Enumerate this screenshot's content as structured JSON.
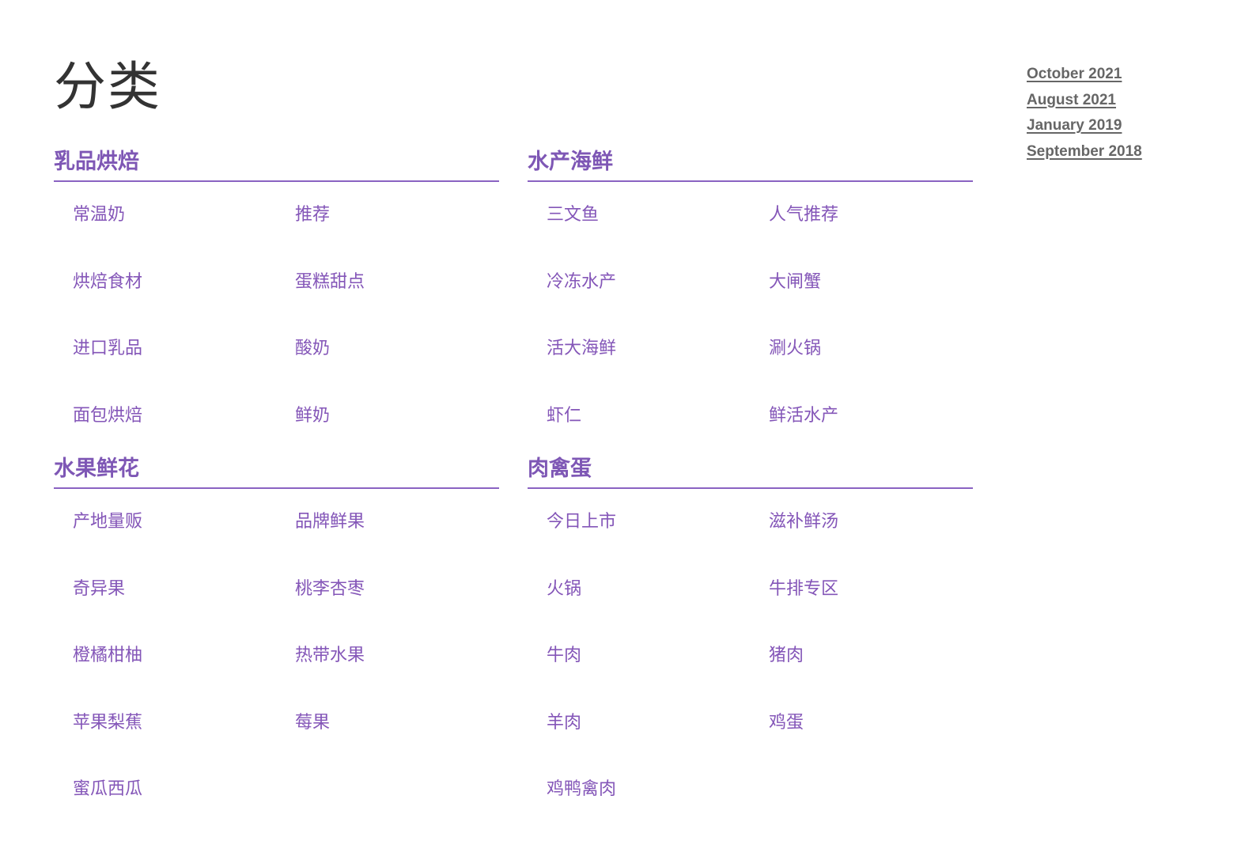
{
  "page": {
    "title": "分类"
  },
  "colors": {
    "heading": "#7e57b5",
    "link": "#8456b8",
    "divider": "#8a63c2",
    "title": "#333333",
    "archive_link": "#666666"
  },
  "sidebar": {
    "archives": [
      {
        "label": "October 2021"
      },
      {
        "label": "August 2021"
      },
      {
        "label": "January 2019"
      },
      {
        "label": "September 2018"
      }
    ]
  },
  "sections": [
    {
      "heading": "乳品烘焙",
      "items": [
        {
          "label": "常温奶"
        },
        {
          "label": "推荐"
        },
        {
          "label": "烘焙食材"
        },
        {
          "label": "蛋糕甜点"
        },
        {
          "label": "进口乳品"
        },
        {
          "label": "酸奶"
        },
        {
          "label": "面包烘焙"
        },
        {
          "label": "鲜奶"
        }
      ]
    },
    {
      "heading": "水产海鲜",
      "items": [
        {
          "label": "三文鱼"
        },
        {
          "label": "人气推荐"
        },
        {
          "label": "冷冻水产"
        },
        {
          "label": "大闸蟹"
        },
        {
          "label": "活大海鲜"
        },
        {
          "label": "涮火锅"
        },
        {
          "label": "虾仁"
        },
        {
          "label": "鲜活水产"
        }
      ]
    },
    {
      "heading": "水果鲜花",
      "items": [
        {
          "label": "产地量贩"
        },
        {
          "label": "品牌鲜果"
        },
        {
          "label": "奇异果"
        },
        {
          "label": "桃李杏枣"
        },
        {
          "label": "橙橘柑柚"
        },
        {
          "label": "热带水果"
        },
        {
          "label": "苹果梨蕉"
        },
        {
          "label": "莓果"
        },
        {
          "label": "蜜瓜西瓜"
        }
      ]
    },
    {
      "heading": "肉禽蛋",
      "items": [
        {
          "label": "今日上市"
        },
        {
          "label": "滋补鲜汤"
        },
        {
          "label": "火锅"
        },
        {
          "label": "牛排专区"
        },
        {
          "label": "牛肉"
        },
        {
          "label": "猪肉"
        },
        {
          "label": "羊肉"
        },
        {
          "label": "鸡蛋"
        },
        {
          "label": "鸡鸭禽肉"
        }
      ]
    }
  ]
}
